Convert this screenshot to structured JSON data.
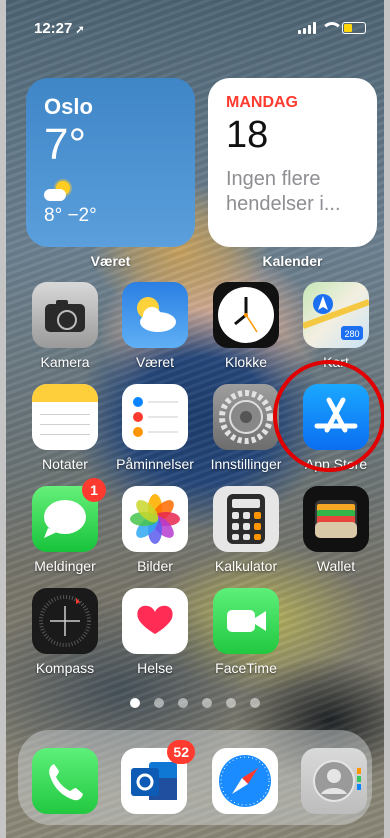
{
  "status_bar": {
    "time": "12:27",
    "battery_color": "#ffd60a"
  },
  "widgets": {
    "weather": {
      "city": "Oslo",
      "temperature": "7°",
      "high_low": "8° −2°",
      "label": "Været",
      "icon": "partly-sunny-icon"
    },
    "calendar": {
      "weekday": "MANDAG",
      "day": "18",
      "events": "Ingen flere hendelser i...",
      "label": "Kalender"
    }
  },
  "apps": [
    {
      "name": "Kamera",
      "icon": "camera-icon"
    },
    {
      "name": "Været",
      "icon": "weather-icon"
    },
    {
      "name": "Klokke",
      "icon": "clock-icon"
    },
    {
      "name": "Kart",
      "icon": "maps-icon",
      "shield": "280"
    },
    {
      "name": "Notater",
      "icon": "notes-icon"
    },
    {
      "name": "Påminnelser",
      "icon": "reminders-icon"
    },
    {
      "name": "Innstillinger",
      "icon": "settings-icon"
    },
    {
      "name": "App Store",
      "icon": "appstore-icon"
    },
    {
      "name": "Meldinger",
      "icon": "messages-icon",
      "badge": "1"
    },
    {
      "name": "Bilder",
      "icon": "photos-icon"
    },
    {
      "name": "Kalkulator",
      "icon": "calculator-icon"
    },
    {
      "name": "Wallet",
      "icon": "wallet-icon"
    },
    {
      "name": "Kompass",
      "icon": "compass-icon"
    },
    {
      "name": "Helse",
      "icon": "health-icon"
    },
    {
      "name": "FaceTime",
      "icon": "facetime-icon"
    }
  ],
  "page_indicator": {
    "pages": 6,
    "current": 1
  },
  "dock": [
    {
      "name": "Telefon",
      "icon": "phone-icon"
    },
    {
      "name": "Outlook",
      "icon": "outlook-icon",
      "badge": "52"
    },
    {
      "name": "Safari",
      "icon": "safari-icon"
    },
    {
      "name": "Kontakter",
      "icon": "contacts-icon"
    }
  ],
  "annotation": {
    "highlight_color": "#e00000",
    "target": "App Store"
  }
}
